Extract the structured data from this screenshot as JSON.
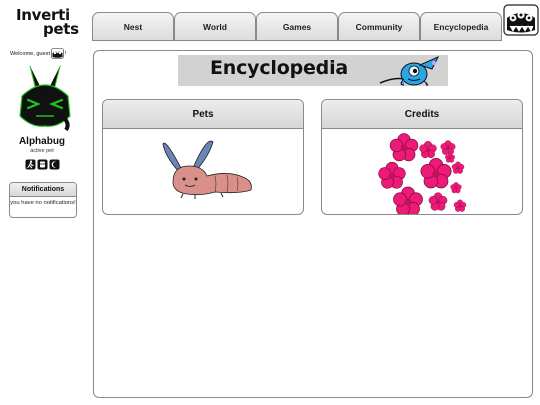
{
  "site": {
    "logo_line1": "Inverti",
    "logo_line2": "pets"
  },
  "nav": {
    "tabs": [
      {
        "label": "Nest"
      },
      {
        "label": "World"
      },
      {
        "label": "Games"
      },
      {
        "label": "Community"
      },
      {
        "label": "Encyclopedia"
      }
    ]
  },
  "sidebar": {
    "welcome": "Welcome, guest",
    "welcome_suffix": "!",
    "pet_name": "Alphabug",
    "pet_status": "active pet",
    "notifications": {
      "title": "Notifications",
      "message": "you have no notifications!"
    }
  },
  "main": {
    "banner_title": "Encyclopedia",
    "sections": [
      {
        "label": "Pets",
        "icon": "rabbit-slug-pet-icon"
      },
      {
        "label": "Credits",
        "icon": "pink-flowers-icon"
      }
    ]
  },
  "colors": {
    "pet_green": "#1fc21f",
    "flower_pink": "#ee1a78",
    "banner_gray": "#d2d2d2"
  }
}
